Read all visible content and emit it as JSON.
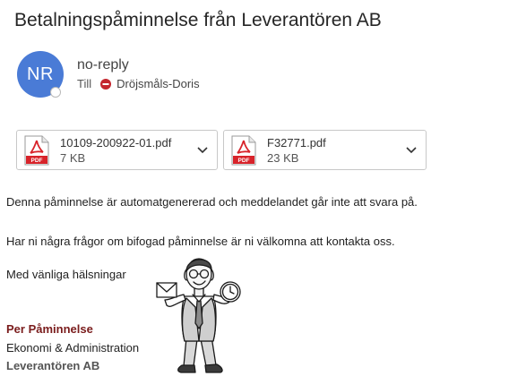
{
  "email": {
    "subject": "Betalningspåminnelse från  Leverantören AB",
    "sender": {
      "initials": "NR",
      "name": "no-reply",
      "to_label": "Till",
      "recipient": "Dröjsmåls-Doris",
      "avatar_color": "#4a7bd6"
    },
    "attachments": [
      {
        "name": "10109-200922-01.pdf",
        "size": "7 KB",
        "icon": "pdf-icon"
      },
      {
        "name": "F32771.pdf",
        "size": "23 KB",
        "icon": "pdf-icon"
      }
    ],
    "body": {
      "line1": "Denna påminnelse är automatgenererad och meddelandet går inte att svara på.",
      "line2": "Har ni några frågor om bifogad påminnelse är ni välkomna att kontakta oss.",
      "closing": "Med vänliga hälsningar"
    },
    "signature": {
      "name": "Per Påminnelse",
      "department": "Ekonomi & Administration",
      "company": "Leverantören AB",
      "name_color": "#7a1c1c"
    }
  }
}
